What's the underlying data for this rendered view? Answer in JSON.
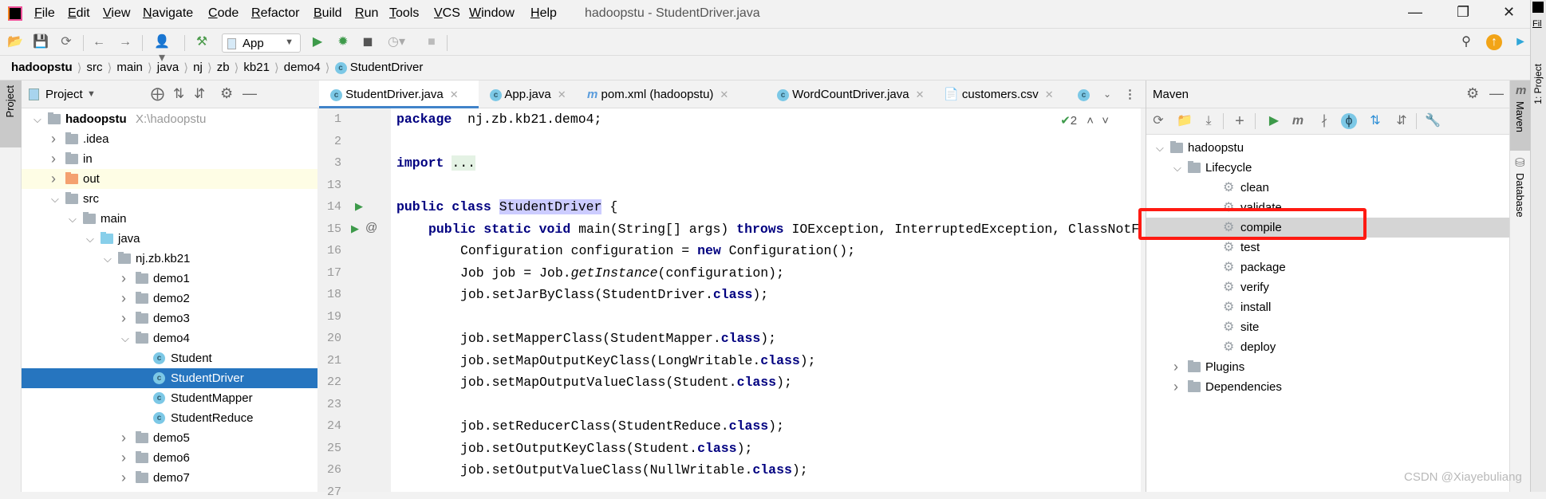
{
  "menu": {
    "items": [
      "File",
      "Edit",
      "View",
      "Navigate",
      "Code",
      "Refactor",
      "Build",
      "Run",
      "Tools",
      "VCS",
      "Window",
      "Help"
    ],
    "title": "hadoopstu - StudentDriver.java"
  },
  "toolbar": {
    "run_config": "App"
  },
  "breadcrumb": [
    "hadoopstu",
    "src",
    "main",
    "java",
    "nj",
    "zb",
    "kb21",
    "demo4",
    "StudentDriver"
  ],
  "left_strip": {
    "label": "Project"
  },
  "project": {
    "title": "Project",
    "tree": [
      {
        "label": "hadoopstu",
        "extra": "X:\\hadoopstu",
        "level": 0,
        "exp": "open",
        "icon": "module",
        "bold": true
      },
      {
        "label": ".idea",
        "level": 1,
        "exp": "closed",
        "icon": "folder"
      },
      {
        "label": "in",
        "level": 1,
        "exp": "closed",
        "icon": "folder"
      },
      {
        "label": "out",
        "level": 1,
        "exp": "closed",
        "icon": "folder-orange",
        "hl": true
      },
      {
        "label": "src",
        "level": 1,
        "exp": "open",
        "icon": "folder"
      },
      {
        "label": "main",
        "level": 2,
        "exp": "open",
        "icon": "folder"
      },
      {
        "label": "java",
        "level": 3,
        "exp": "open",
        "icon": "folder-blue"
      },
      {
        "label": "nj.zb.kb21",
        "level": 4,
        "exp": "open",
        "icon": "package"
      },
      {
        "label": "demo1",
        "level": 5,
        "exp": "closed",
        "icon": "package"
      },
      {
        "label": "demo2",
        "level": 5,
        "exp": "closed",
        "icon": "package"
      },
      {
        "label": "demo3",
        "level": 5,
        "exp": "closed",
        "icon": "package"
      },
      {
        "label": "demo4",
        "level": 5,
        "exp": "open",
        "icon": "package"
      },
      {
        "label": "Student",
        "level": 6,
        "icon": "class"
      },
      {
        "label": "StudentDriver",
        "level": 6,
        "icon": "class-run",
        "selected": true
      },
      {
        "label": "StudentMapper",
        "level": 6,
        "icon": "class"
      },
      {
        "label": "StudentReduce",
        "level": 6,
        "icon": "class"
      },
      {
        "label": "demo5",
        "level": 5,
        "exp": "closed",
        "icon": "package"
      },
      {
        "label": "demo6",
        "level": 5,
        "exp": "closed",
        "icon": "package"
      },
      {
        "label": "demo7",
        "level": 5,
        "exp": "closed",
        "icon": "package"
      }
    ]
  },
  "tabs": [
    {
      "label": "StudentDriver.java",
      "icon": "class",
      "active": true
    },
    {
      "label": "App.java",
      "icon": "class"
    },
    {
      "label": "pom.xml (hadoopstu)",
      "icon": "maven"
    },
    {
      "label": "WordCountDriver.java",
      "icon": "class"
    },
    {
      "label": "customers.csv",
      "icon": "file"
    }
  ],
  "editor": {
    "inspection_count": "2",
    "lines": [
      {
        "n": "1",
        "ind": 0,
        "t": [
          [
            "k",
            "package"
          ],
          [
            "",
            "  nj.zb.kb21.demo4;"
          ]
        ]
      },
      {
        "n": "2",
        "ind": 0,
        "t": []
      },
      {
        "n": "3",
        "ind": 0,
        "t": [
          [
            "k",
            "import"
          ],
          [
            "",
            " "
          ],
          [
            "fd",
            "..."
          ]
        ]
      },
      {
        "n": "13",
        "ind": 0,
        "t": []
      },
      {
        "n": "14",
        "ind": 0,
        "run": true,
        "t": [
          [
            "k",
            "public class"
          ],
          [
            "",
            " "
          ],
          [
            "hlc",
            "StudentDriver"
          ],
          [
            "",
            " {"
          ]
        ]
      },
      {
        "n": "15",
        "ind": 4,
        "run": true,
        "at": true,
        "t": [
          [
            "k",
            "public static void"
          ],
          [
            "",
            " main(String[] args) "
          ],
          [
            "k",
            "throws"
          ],
          [
            "",
            " IOException, InterruptedException, ClassNotFoundException {"
          ]
        ]
      },
      {
        "n": "16",
        "ind": 8,
        "t": [
          [
            "",
            "Configuration configuration = "
          ],
          [
            "k",
            "new"
          ],
          [
            "",
            " Configuration();"
          ]
        ]
      },
      {
        "n": "17",
        "ind": 8,
        "t": [
          [
            "",
            "Job job = Job."
          ],
          [
            "it",
            "getInstance"
          ],
          [
            "",
            "(configuration);"
          ]
        ]
      },
      {
        "n": "18",
        "ind": 8,
        "t": [
          [
            "",
            "job.setJarByClass(StudentDriver."
          ],
          [
            "k",
            "class"
          ],
          [
            "",
            ");"
          ]
        ]
      },
      {
        "n": "19",
        "ind": 0,
        "t": []
      },
      {
        "n": "20",
        "ind": 8,
        "t": [
          [
            "",
            "job.setMapperClass(StudentMapper."
          ],
          [
            "k",
            "class"
          ],
          [
            "",
            ");"
          ]
        ]
      },
      {
        "n": "21",
        "ind": 8,
        "t": [
          [
            "",
            "job.setMapOutputKeyClass(LongWritable."
          ],
          [
            "k",
            "class"
          ],
          [
            "",
            ");"
          ]
        ]
      },
      {
        "n": "22",
        "ind": 8,
        "t": [
          [
            "",
            "job.setMapOutputValueClass(Student."
          ],
          [
            "k",
            "class"
          ],
          [
            "",
            ");"
          ]
        ]
      },
      {
        "n": "23",
        "ind": 0,
        "t": []
      },
      {
        "n": "24",
        "ind": 8,
        "t": [
          [
            "",
            "job.setReducerClass(StudentReduce."
          ],
          [
            "k",
            "class"
          ],
          [
            "",
            ");"
          ]
        ]
      },
      {
        "n": "25",
        "ind": 8,
        "t": [
          [
            "",
            "job.setOutputKeyClass(Student."
          ],
          [
            "k",
            "class"
          ],
          [
            "",
            ");"
          ]
        ]
      },
      {
        "n": "26",
        "ind": 8,
        "t": [
          [
            "",
            "job.setOutputValueClass(NullWritable."
          ],
          [
            "k",
            "class"
          ],
          [
            "",
            ");"
          ]
        ]
      },
      {
        "n": "27",
        "ind": 0,
        "t": []
      }
    ]
  },
  "maven": {
    "title": "Maven",
    "tree": [
      {
        "label": "hadoopstu",
        "level": 0,
        "exp": "open",
        "icon": "maven-module"
      },
      {
        "label": "Lifecycle",
        "level": 1,
        "exp": "open",
        "icon": "lifecycle"
      },
      {
        "label": "clean",
        "level": 2,
        "icon": "gear"
      },
      {
        "label": "validate",
        "level": 2,
        "icon": "gear"
      },
      {
        "label": "compile",
        "level": 2,
        "icon": "gear",
        "selected": true
      },
      {
        "label": "test",
        "level": 2,
        "icon": "gear"
      },
      {
        "label": "package",
        "level": 2,
        "icon": "gear"
      },
      {
        "label": "verify",
        "level": 2,
        "icon": "gear"
      },
      {
        "label": "install",
        "level": 2,
        "icon": "gear"
      },
      {
        "label": "site",
        "level": 2,
        "icon": "gear"
      },
      {
        "label": "deploy",
        "level": 2,
        "icon": "gear"
      },
      {
        "label": "Plugins",
        "level": 1,
        "exp": "closed",
        "icon": "plugins"
      },
      {
        "label": "Dependencies",
        "level": 1,
        "exp": "closed",
        "icon": "dependencies"
      }
    ]
  },
  "right_strip": {
    "maven": "Maven",
    "database": "Database",
    "project2": "1: Project",
    "file2": "Fil"
  },
  "watermark": "CSDN @Xiayebuliang",
  "colors": {
    "selection": "#2675bf",
    "highlight_box": "#ff1a12",
    "keyword": "#000080"
  }
}
